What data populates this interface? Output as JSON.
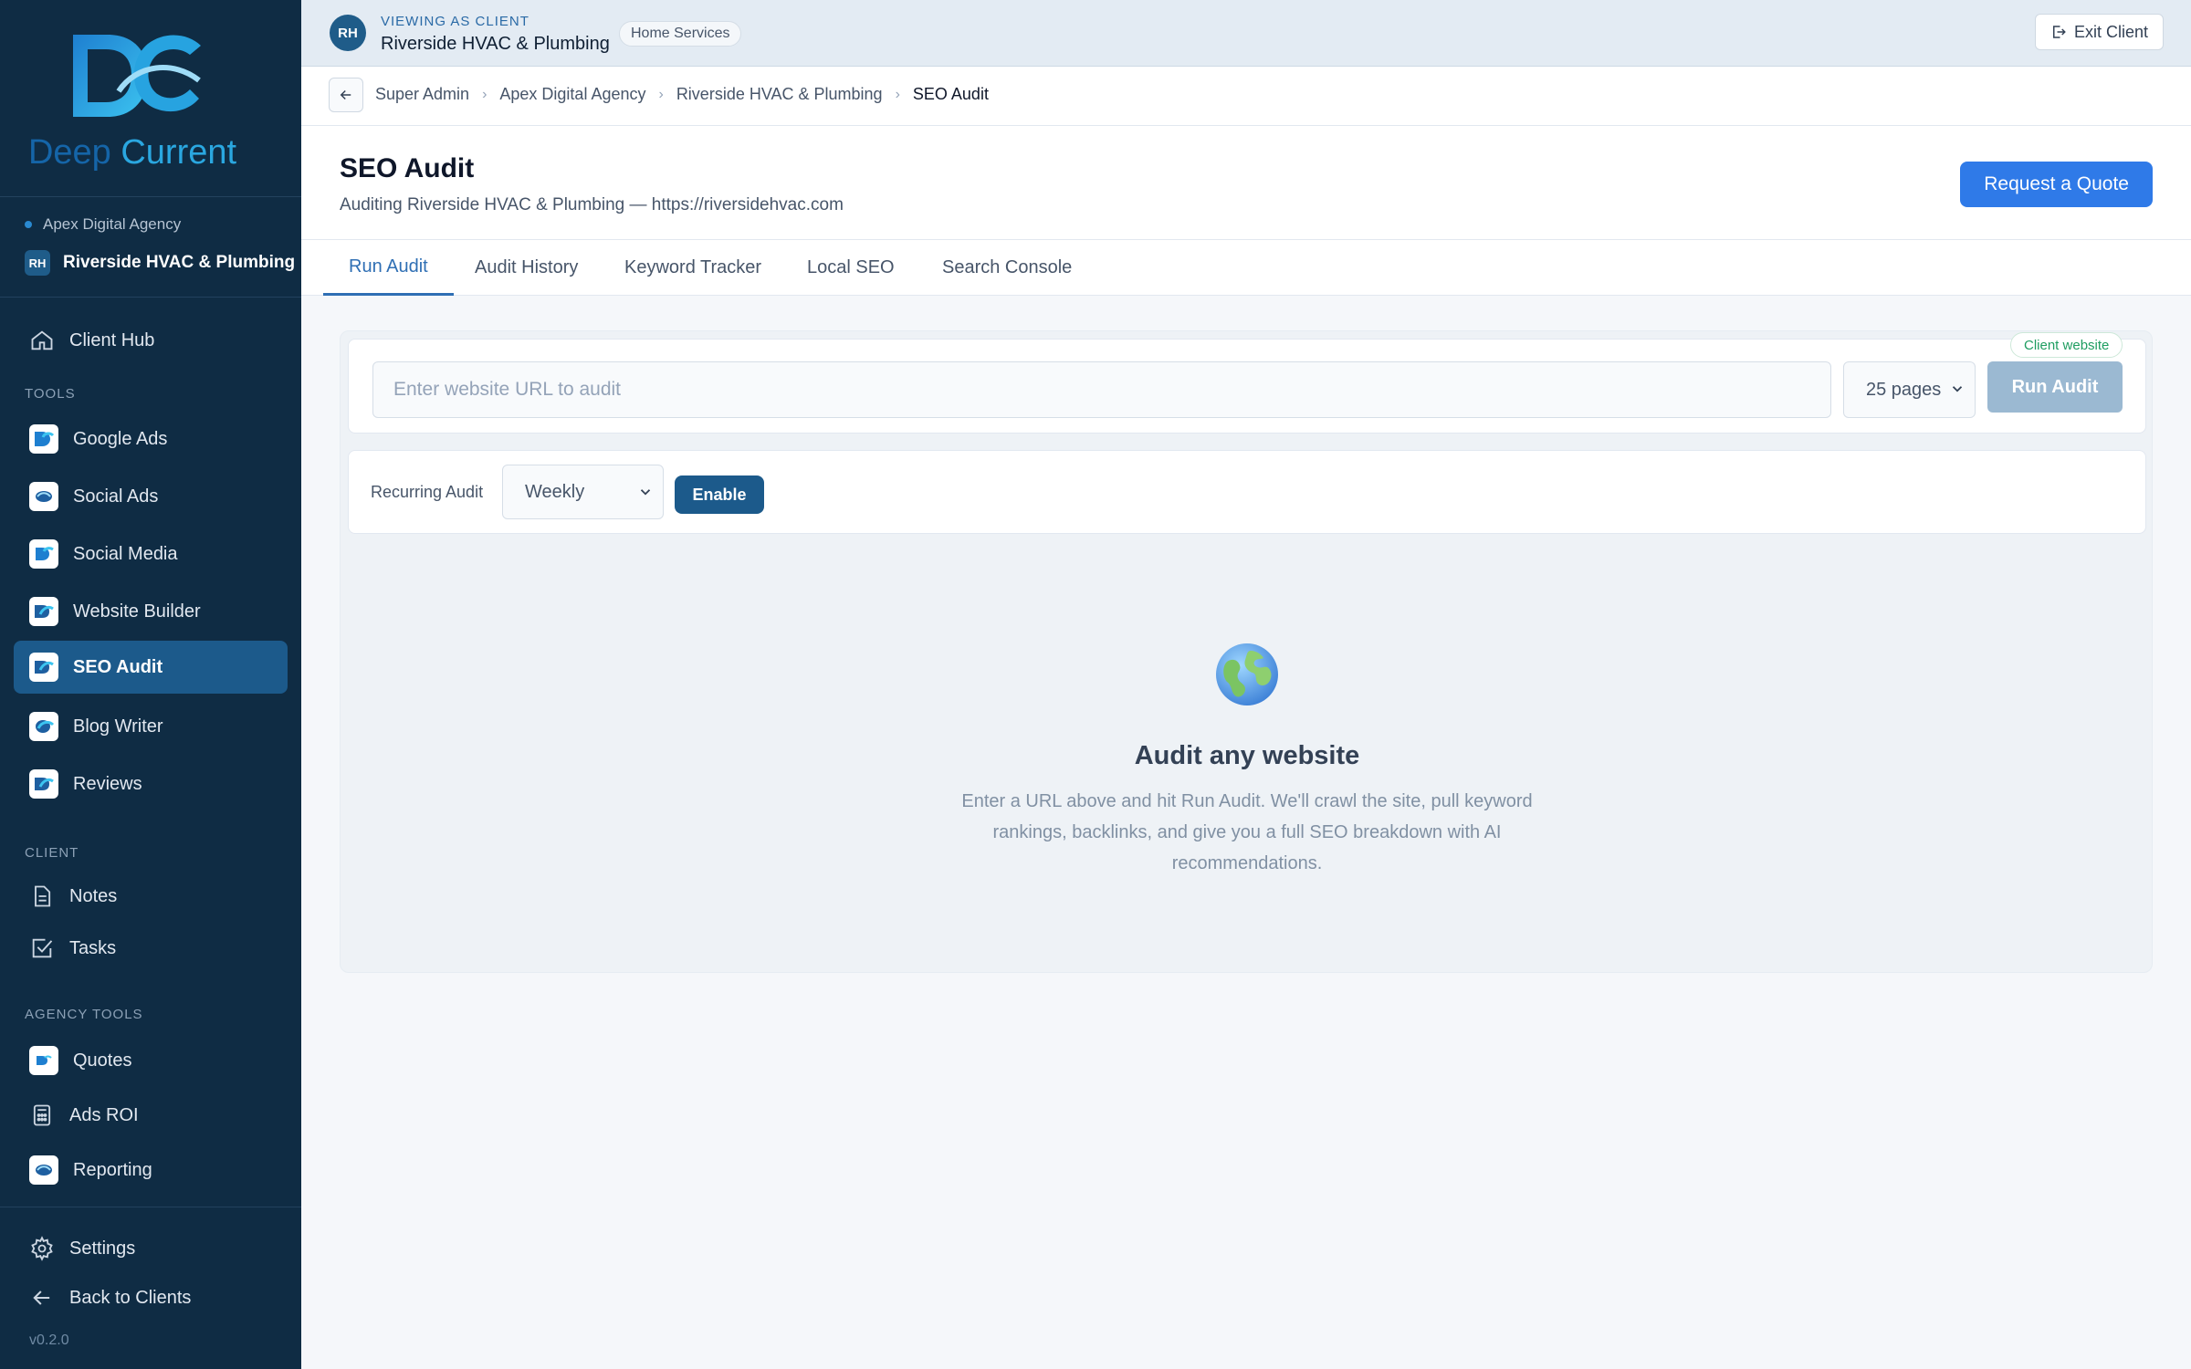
{
  "brand": {
    "word1": "Deep",
    "word2": "Current"
  },
  "sidebar": {
    "agency": "Apex Digital Agency",
    "client_initials": "RH",
    "client_name": "Riverside HVAC & Plumbing",
    "client_hub": "Client Hub",
    "tools_label": "TOOLS",
    "tools": [
      {
        "label": "Google Ads"
      },
      {
        "label": "Social Ads"
      },
      {
        "label": "Social Media"
      },
      {
        "label": "Website Builder"
      },
      {
        "label": "SEO Audit"
      },
      {
        "label": "Blog Writer"
      },
      {
        "label": "Reviews"
      }
    ],
    "client_label": "CLIENT",
    "client_items": [
      {
        "label": "Notes"
      },
      {
        "label": "Tasks"
      }
    ],
    "agency_tools_label": "AGENCY TOOLS",
    "agency_items": [
      {
        "label": "Quotes"
      },
      {
        "label": "Ads ROI"
      },
      {
        "label": "Reporting"
      }
    ],
    "settings": "Settings",
    "back": "Back to Clients",
    "version": "v0.2.0"
  },
  "topbar": {
    "initials": "RH",
    "viewing_label": "VIEWING AS CLIENT",
    "client_name": "Riverside HVAC & Plumbing",
    "industry_tag": "Home Services",
    "exit_label": "Exit Client"
  },
  "breadcrumb": [
    "Super Admin",
    "Apex Digital Agency",
    "Riverside HVAC & Plumbing",
    "SEO Audit"
  ],
  "header": {
    "title": "SEO Audit",
    "subtitle": "Auditing Riverside HVAC & Plumbing — https://riversidehvac.com",
    "quote_button": "Request a Quote"
  },
  "tabs": [
    "Run Audit",
    "Audit History",
    "Keyword Tracker",
    "Local SEO",
    "Search Console"
  ],
  "audit": {
    "url_placeholder": "Enter website URL to audit",
    "pages_value": "25 pages",
    "run_button": "Run Audit",
    "client_website_pill": "Client website",
    "recurring_label": "Recurring Audit",
    "recurring_value": "Weekly",
    "enable_button": "Enable"
  },
  "empty_state": {
    "title": "Audit any website",
    "text": "Enter a URL above and hit Run Audit. We'll crawl the site, pull keyword rankings, backlinks, and give you a full SEO breakdown with AI recommendations."
  }
}
